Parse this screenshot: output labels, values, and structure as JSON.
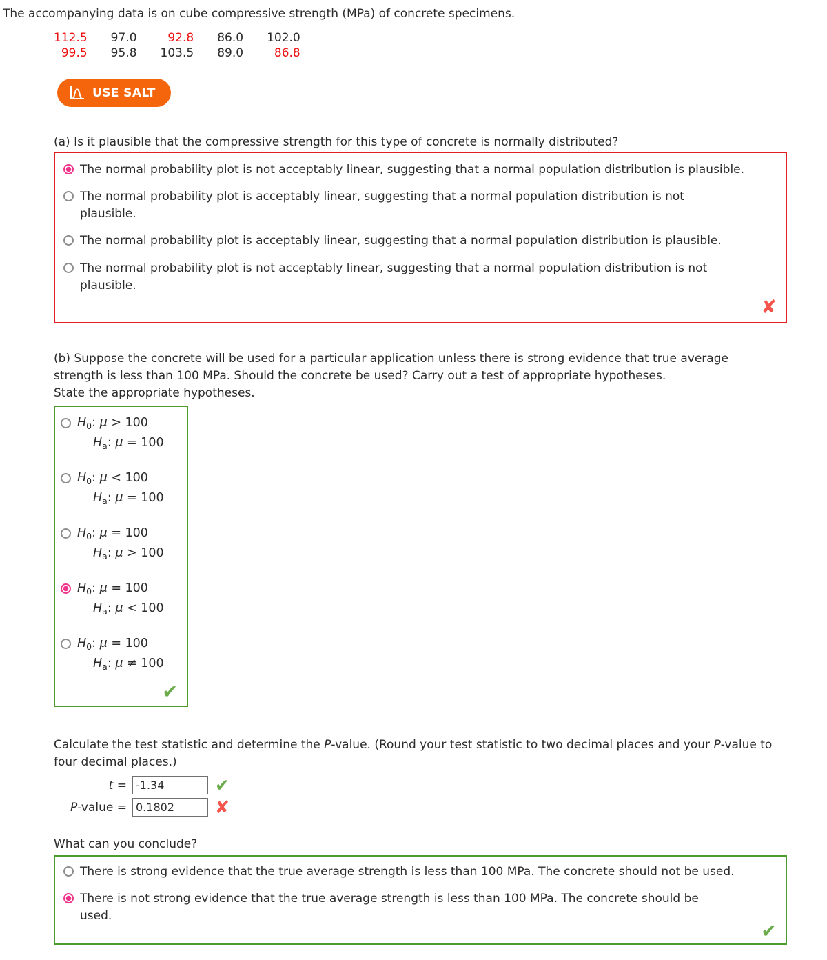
{
  "intro": "The accompanying data is on cube compressive strength (MPa) of concrete specimens.",
  "data_values": {
    "rows": [
      [
        {
          "value": "112.5",
          "color": "red"
        },
        {
          "value": "97.0",
          "color": "black"
        },
        {
          "value": "92.8",
          "color": "red"
        },
        {
          "value": "86.0",
          "color": "black"
        },
        {
          "value": "102.0",
          "color": "black"
        }
      ],
      [
        {
          "value": "99.5",
          "color": "red"
        },
        {
          "value": "95.8",
          "color": "black"
        },
        {
          "value": "103.5",
          "color": "black"
        },
        {
          "value": "89.0",
          "color": "black"
        },
        {
          "value": "86.8",
          "color": "red"
        }
      ]
    ],
    "red_hex": "#ee1111",
    "black_hex": "#2b2b2b"
  },
  "salt_button": {
    "label": "USE SALT",
    "icon": "distribution-curve-icon",
    "background_hex": "#f4650c",
    "text_hex": "#ffffff"
  },
  "part_a": {
    "prompt": "(a) Is it plausible that the compressive strength for this type of concrete is normally distributed?",
    "border_color_hex": "#e02020",
    "result_mark": "✘",
    "result_mark_color_hex": "#f4544b",
    "options": [
      {
        "text": "The normal probability plot is not acceptably linear, suggesting that a normal population distribution is plausible.",
        "selected": true
      },
      {
        "text": "The normal probability plot is acceptably linear, suggesting that a normal population distribution is not plausible.",
        "selected": false
      },
      {
        "text": "The normal probability plot is acceptably linear, suggesting that a normal population distribution is plausible.",
        "selected": false
      },
      {
        "text": "The normal probability plot is not acceptably linear, suggesting that a normal population distribution is not plausible.",
        "selected": false
      }
    ]
  },
  "part_b": {
    "prompt_line1": "(b) Suppose the concrete will be used for a particular application unless there is strong evidence that true average",
    "prompt_line2": "strength is less than 100 MPa. Should the concrete be used? Carry out a test of appropriate hypotheses.",
    "prompt_line3": "State the appropriate hypotheses.",
    "border_color_hex": "#4a9c2d",
    "result_mark": "✔",
    "result_mark_color_hex": "#6aab4a",
    "hypotheses": [
      {
        "null": "> 100",
        "alt": "= 100",
        "selected": false
      },
      {
        "null": "< 100",
        "alt": "= 100",
        "selected": false
      },
      {
        "null": "= 100",
        "alt": "> 100",
        "selected": false
      },
      {
        "null": "= 100",
        "alt": "< 100",
        "selected": true
      },
      {
        "null": "= 100",
        "alt": "≠ 100",
        "selected": false
      }
    ],
    "symbols": {
      "h_null": "H",
      "h_null_sub": "0",
      "h_alt": "H",
      "h_alt_sub": "a",
      "mu": "μ",
      "colon": ":"
    }
  },
  "test_statistic": {
    "prompt_line1": "Calculate the test statistic and determine the P-value. (Round your test statistic to two decimal places and your P-value to",
    "prompt_line2": "four decimal places.)",
    "fields": [
      {
        "label_prefix": "t",
        "label_suffix": " = ",
        "value": "-1.34",
        "mark": "✔",
        "mark_color_hex": "#6aab4a"
      },
      {
        "label_prefix": "P",
        "label_suffix": "-value = ",
        "value": "0.1802",
        "mark": "✘",
        "mark_color_hex": "#f4544b"
      }
    ]
  },
  "conclusion": {
    "prompt": "What can you conclude?",
    "border_color_hex": "#4a9c2d",
    "result_mark": "✔",
    "result_mark_color_hex": "#6aab4a",
    "options": [
      {
        "text": "There is strong evidence that the true average strength is less than 100 MPa. The concrete should not be used.",
        "selected": false
      },
      {
        "text": "There is not strong evidence that the true average strength is less than 100 MPa. The concrete should be used.",
        "selected": true
      }
    ]
  }
}
